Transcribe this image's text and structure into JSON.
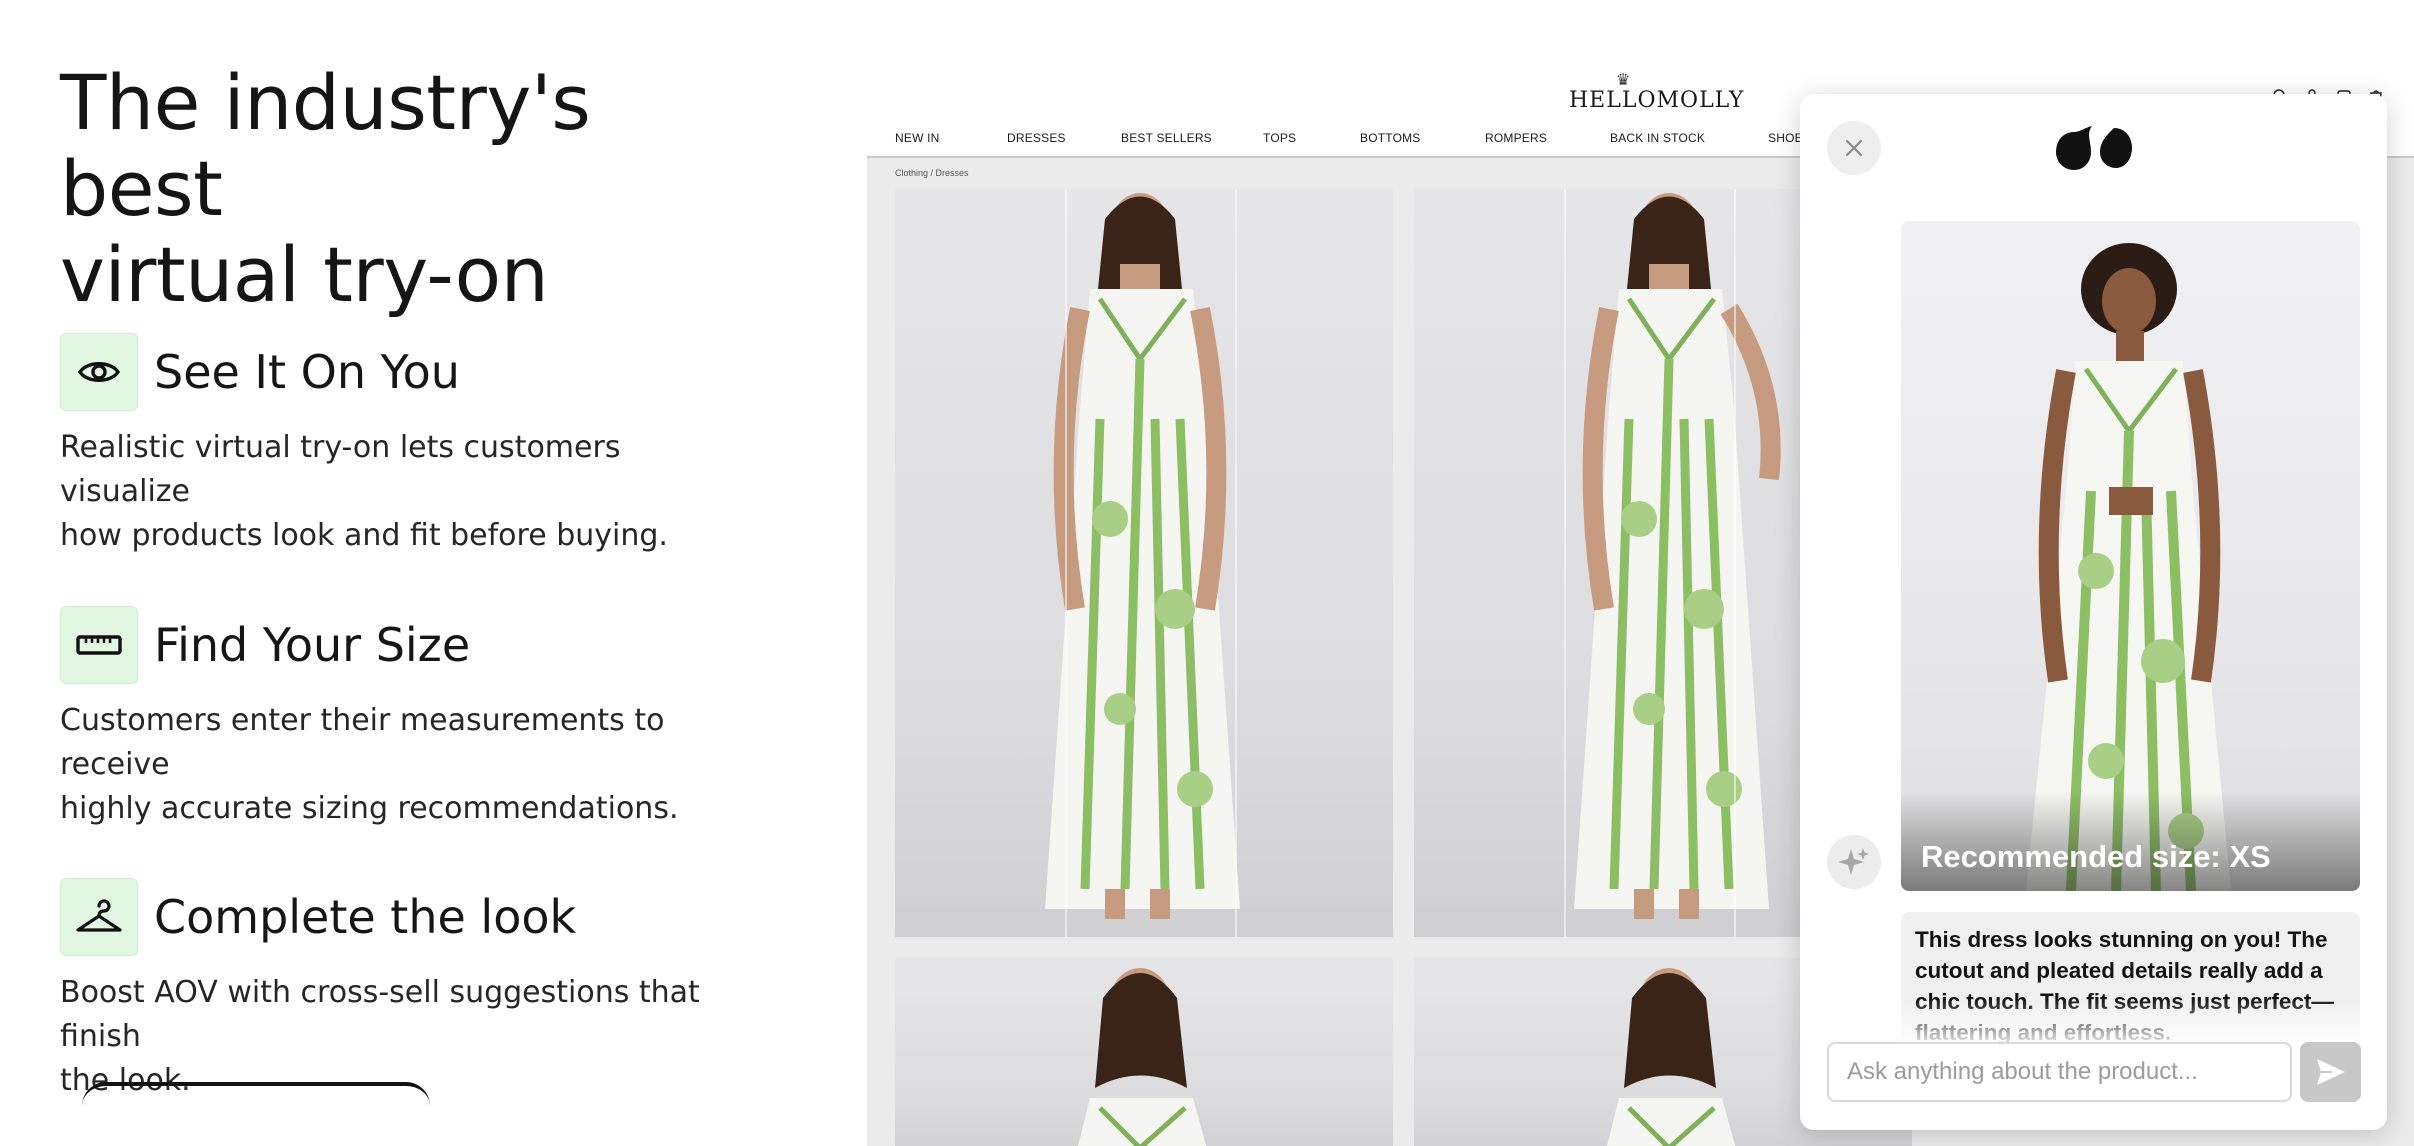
{
  "hero": {
    "title_line1": "The industry's best",
    "title_line2": "virtual try-on"
  },
  "features": [
    {
      "icon": "eye-icon",
      "title": "See It On You",
      "desc_line1": "Realistic virtual try-on lets customers visualize",
      "desc_line2": "how products look and fit before buying."
    },
    {
      "icon": "ruler-icon",
      "title": "Find Your Size",
      "desc_line1": "Customers enter their measurements to receive",
      "desc_line2": "highly accurate sizing recommendations."
    },
    {
      "icon": "hanger-icon",
      "title": "Complete the look",
      "desc_line1": "Boost AOV with cross-sell suggestions that finish",
      "desc_line2": "the look."
    }
  ],
  "store": {
    "logo": "HELLOMOLLY",
    "nav": [
      "NEW IN",
      "DRESSES",
      "BEST SELLERS",
      "TOPS",
      "BOTTOMS",
      "ROMPERS",
      "BACK IN STOCK",
      "SHOES"
    ],
    "breadcrumb": "Clothing  /  Dresses",
    "header_icons": [
      "search-icon",
      "account-icon",
      "wishlist-icon",
      "bag-icon"
    ]
  },
  "widget": {
    "recommended_size": "Recommended size: XS",
    "message": "This dress looks stunning on you! The cutout and pleated details really add a chic touch. The fit seems just perfect—flattering and effortless.",
    "input_placeholder": "Ask anything about the product...",
    "colors": {
      "accent_green": "#6fa84e",
      "feature_icon_bg": "#e2f7e2"
    }
  }
}
